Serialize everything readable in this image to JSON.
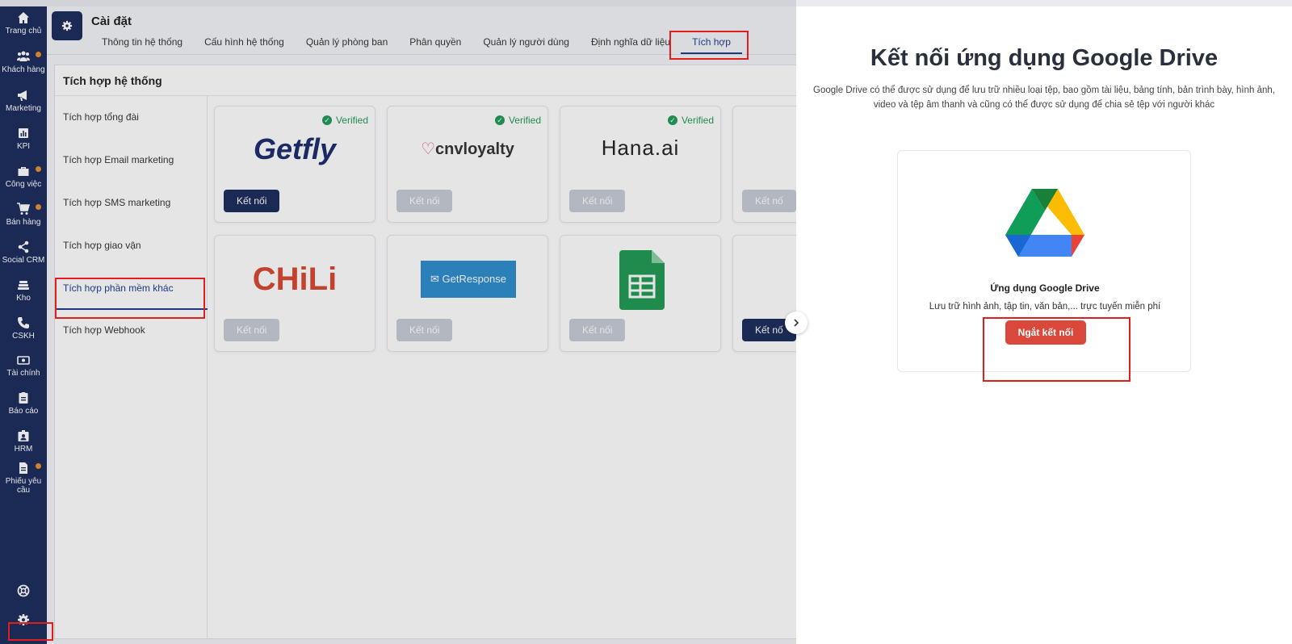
{
  "nav": {
    "items": [
      {
        "label": "Trang chủ",
        "icon": "home-icon"
      },
      {
        "label": "Khách hàng",
        "icon": "users-icon"
      },
      {
        "label": "Marketing",
        "icon": "megaphone-icon"
      },
      {
        "label": "KPI",
        "icon": "chart-icon"
      },
      {
        "label": "Công việc",
        "icon": "briefcase-icon"
      },
      {
        "label": "Bán hàng",
        "icon": "cart-icon"
      },
      {
        "label": "Social CRM",
        "icon": "share-icon"
      },
      {
        "label": "Kho",
        "icon": "warehouse-icon"
      },
      {
        "label": "CSKH",
        "icon": "phone-icon"
      },
      {
        "label": "Tài chính",
        "icon": "money-icon"
      },
      {
        "label": "Báo cáo",
        "icon": "clipboard-icon"
      },
      {
        "label": "HRM",
        "icon": "id-badge-icon"
      },
      {
        "label": "Phiếu yêu cầu",
        "icon": "document-icon"
      }
    ],
    "notification_color": "#e88e2c",
    "bottom_icons": [
      "support-icon",
      "gear-icon"
    ]
  },
  "header": {
    "title": "Cài đặt",
    "tabs": [
      "Thông tin hệ thống",
      "Cấu hình hệ thống",
      "Quản lý phòng ban",
      "Phân quyền",
      "Quản lý người dùng",
      "Định nghĩa dữ liệu",
      "Tích hợp"
    ],
    "active_tab": "Tích hợp"
  },
  "panel": {
    "title": "Tích hợp hệ thống",
    "submenu": [
      "Tích hợp tổng đài",
      "Tích hợp Email marketing",
      "Tích hợp SMS marketing",
      "Tích hợp giao vận",
      "Tích hợp phần mềm khác",
      "Tích hợp Webhook"
    ],
    "active_submenu": "Tích hợp phần mềm khác"
  },
  "cards": {
    "verified_label": "Verified",
    "connect_label": "Kết nối",
    "row1": [
      {
        "name": "Getfly",
        "verified": true,
        "enabled": true
      },
      {
        "name": "cnvloyalty",
        "verified": true,
        "enabled": false
      },
      {
        "name": "Hana.ai",
        "verified": true,
        "enabled": false
      }
    ],
    "row2": [
      {
        "name": "CHiLi",
        "enabled": false
      },
      {
        "name": "GetResponse",
        "enabled": false
      },
      {
        "name": "Google Sheets",
        "enabled": false
      }
    ],
    "partial_label": "Kết nố"
  },
  "drawer": {
    "title": "Kết nối ứng dụng Google Drive",
    "description": "Google Drive có thể được sử dụng để lưu trữ nhiều loại tệp, bao gồm tài liệu, bảng tính, bản trình bày, hình ảnh, video và tệp âm thanh và cũng có thể được sử dụng để chia sẻ tệp với người khác",
    "app_name": "Ứng dụng Google Drive",
    "app_subtitle": "Lưu trữ hình ảnh, tập tin, văn bản,... trực tuyến miễn phí",
    "disconnect_label": "Ngắt kết nối"
  },
  "colors": {
    "brand": "#1a2b5b",
    "danger": "#d9483b",
    "verified": "#1f9a56",
    "highlight": "#e01e1e"
  }
}
